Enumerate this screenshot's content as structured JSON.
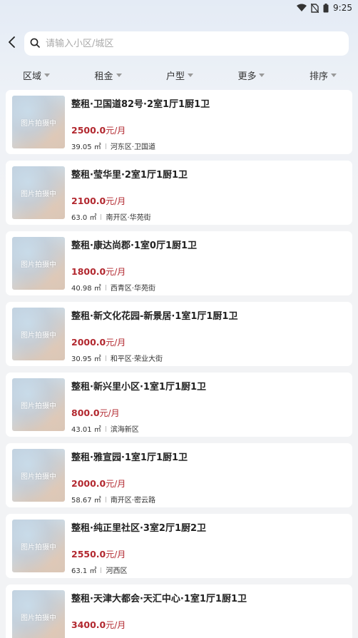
{
  "status_bar": {
    "time": "9:25"
  },
  "search": {
    "placeholder": "请输入小区/城区"
  },
  "filters": [
    "区域",
    "租金",
    "户型",
    "更多",
    "排序"
  ],
  "thumb_label": "图片拍摄中",
  "listings": [
    {
      "title": "整租·卫国道82号·2室1厅1厨1卫",
      "price": "2500.0",
      "unit": "元/月",
      "area": "39.05 ㎡",
      "location": "河东区·卫国道"
    },
    {
      "title": "整租·莹华里·2室1厅1厨1卫",
      "price": "2100.0",
      "unit": "元/月",
      "area": "63.0 ㎡",
      "location": "南开区·华苑街"
    },
    {
      "title": "整租·康达尚郡·1室0厅1厨1卫",
      "price": "1800.0",
      "unit": "元/月",
      "area": "40.98 ㎡",
      "location": "西青区·华苑街"
    },
    {
      "title": "整租·新文化花园-新景居·1室1厅1厨1卫",
      "price": "2000.0",
      "unit": "元/月",
      "area": "30.95 ㎡",
      "location": "和平区·荣业大街"
    },
    {
      "title": "整租·新兴里小区·1室1厅1厨1卫",
      "price": "800.0",
      "unit": "元/月",
      "area": "43.01 ㎡",
      "location": "滨海新区"
    },
    {
      "title": "整租·雅宣园·1室1厅1厨1卫",
      "price": "2000.0",
      "unit": "元/月",
      "area": "58.67 ㎡",
      "location": "南开区·密云路"
    },
    {
      "title": "整租·纯正里社区·3室2厅1厨2卫",
      "price": "2550.0",
      "unit": "元/月",
      "area": "63.1 ㎡",
      "location": "河西区"
    },
    {
      "title": "整租·天津大都会·天汇中心·1室1厅1厨1卫",
      "price": "3400.0",
      "unit": "元/月",
      "area": "",
      "location": ""
    }
  ],
  "colors": {
    "price": "#b2282f",
    "background": "#f2f3f5"
  }
}
